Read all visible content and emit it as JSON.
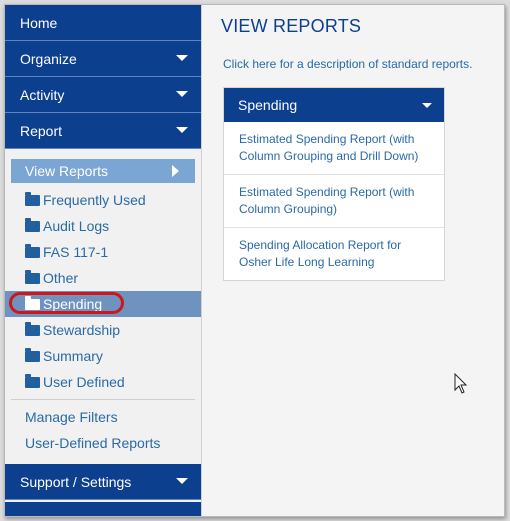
{
  "sidebar": {
    "nav": [
      {
        "label": "Home",
        "has_caret": false
      },
      {
        "label": "Organize",
        "has_caret": true
      },
      {
        "label": "Activity",
        "has_caret": true
      },
      {
        "label": "Report",
        "has_caret": true
      }
    ],
    "view_reports_label": "View Reports",
    "folders": [
      {
        "label": "Frequently Used",
        "active": false
      },
      {
        "label": "Audit Logs",
        "active": false
      },
      {
        "label": "FAS 117-1",
        "active": false
      },
      {
        "label": "Other",
        "active": false
      },
      {
        "label": "Spending",
        "active": true
      },
      {
        "label": "Stewardship",
        "active": false
      },
      {
        "label": "Summary",
        "active": false
      },
      {
        "label": "User Defined",
        "active": false
      }
    ],
    "links": [
      "Manage Filters",
      "User-Defined Reports"
    ],
    "support_label": "Support / Settings"
  },
  "main": {
    "title": "VIEW REPORTS",
    "desc_link": "Click here",
    "desc_rest": " for a description of standard reports.",
    "panel": {
      "header": "Spending",
      "reports": [
        "Estimated Spending Report (with Column Grouping and Drill Down)",
        "Estimated Spending Report (with Column Grouping)",
        "Spending Allocation Report for Osher Life Long Learning"
      ]
    }
  },
  "colors": {
    "nav_bg": "#0d3f8f",
    "accent_light": "#7ba6d4",
    "active_folder_bg": "#6e93bf",
    "link": "#2a6aa6",
    "highlight_ring": "#d0161a"
  }
}
